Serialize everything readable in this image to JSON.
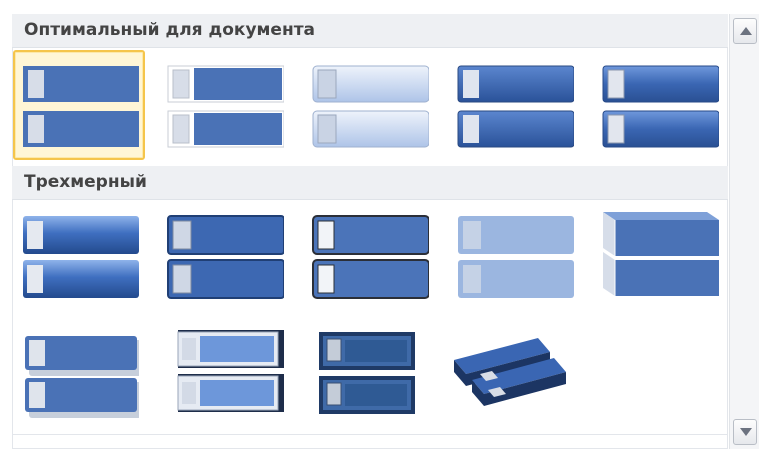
{
  "sections": [
    {
      "title": "Оптимальный для документа"
    },
    {
      "title": "Трехмерный"
    }
  ],
  "gallery": {
    "styles_doc": [
      {
        "name": "simple-fill",
        "selected": true
      },
      {
        "name": "white-outline",
        "selected": false
      },
      {
        "name": "subtle-light",
        "selected": false
      },
      {
        "name": "moderate-dark",
        "selected": false
      },
      {
        "name": "intense-gradient",
        "selected": false
      }
    ],
    "styles_3d": [
      {
        "name": "3d-polished"
      },
      {
        "name": "3d-inset"
      },
      {
        "name": "3d-outline-dark"
      },
      {
        "name": "3d-light-pale"
      },
      {
        "name": "3d-perspective-block"
      },
      {
        "name": "3d-soft-shadow"
      },
      {
        "name": "3d-framed-light"
      },
      {
        "name": "3d-framed-dark"
      },
      {
        "name": "3d-tilted"
      }
    ]
  },
  "colors": {
    "accent": "#4a72b6",
    "accent_dark": "#2f5597",
    "light": "#9ab3dc",
    "selected_border": "#f5c54b",
    "header_bg": "#eef0f3"
  },
  "scrollbar": {
    "up_icon": "chevron-up-icon",
    "down_icon": "chevron-down-icon"
  }
}
